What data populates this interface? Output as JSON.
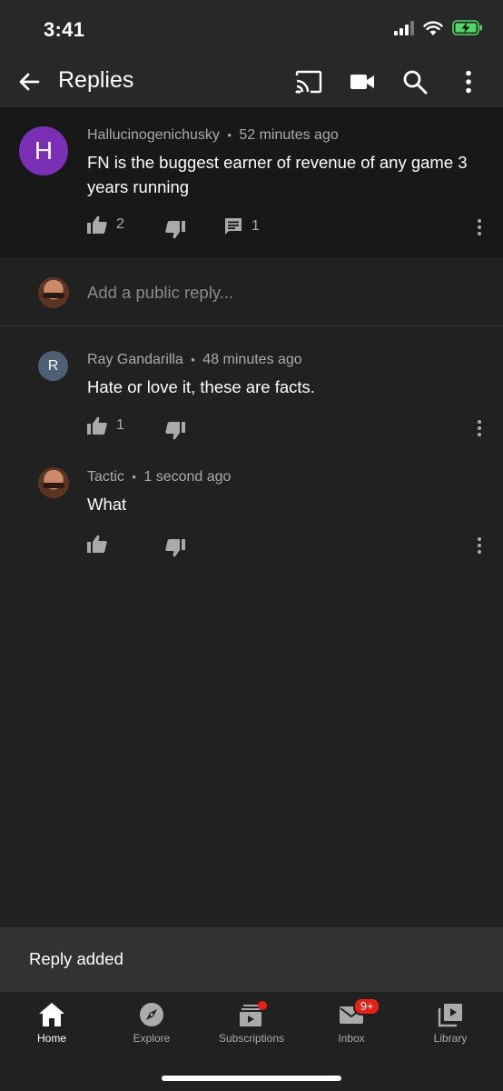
{
  "status_bar": {
    "time": "3:41"
  },
  "app_bar": {
    "title": "Replies"
  },
  "main_comment": {
    "avatar_letter": "H",
    "avatar_color": "#7b2fb5",
    "author": "Hallucinogenichusky",
    "separator": "•",
    "time": "52 minutes ago",
    "text": "FN is the buggest earner of revenue of any game 3 years running",
    "likes": "2",
    "replies": "1"
  },
  "reply_box": {
    "placeholder": "Add a public reply..."
  },
  "replies": [
    {
      "avatar_letter": "R",
      "author": "Ray Gandarilla",
      "separator": "•",
      "time": "48 minutes ago",
      "text": "Hate or love it, these are facts.",
      "likes": "1"
    },
    {
      "author": "Tactic",
      "separator": "•",
      "time": "1 second ago",
      "text": "What",
      "likes": ""
    }
  ],
  "snackbar": {
    "message": "Reply added"
  },
  "bottom_nav": {
    "items": [
      {
        "label": "Home",
        "icon": "home-icon"
      },
      {
        "label": "Explore",
        "icon": "compass-icon"
      },
      {
        "label": "Subscriptions",
        "icon": "subscriptions-icon"
      },
      {
        "label": "Inbox",
        "icon": "inbox-icon",
        "badge": "9+"
      },
      {
        "label": "Library",
        "icon": "library-icon"
      }
    ]
  },
  "colors": {
    "accent": "#e62117",
    "background": "#212121",
    "surface": "#282828"
  }
}
